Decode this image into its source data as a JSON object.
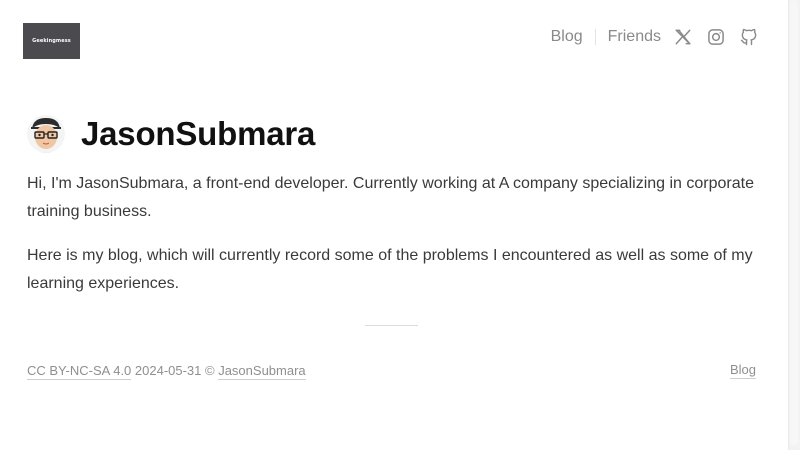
{
  "header": {
    "logo_text": "Geekingmess",
    "nav": {
      "blog_label": "Blog",
      "friends_label": "Friends",
      "icons": [
        "x-twitter-icon",
        "instagram-icon",
        "github-icon"
      ]
    }
  },
  "main": {
    "title": "JasonSubmara",
    "paragraphs": [
      "Hi, I'm JasonSubmara, a front-end developer. Currently working at A company specializing in corporate training business.",
      "Here is my blog, which will currently record some of the problems I encountered as well as some of my learning experiences."
    ]
  },
  "footer": {
    "license_label": "CC BY-NC-SA 4.0",
    "date_text": " 2024-05-31 © ",
    "author_label": "JasonSubmara",
    "blog_label": "Blog"
  },
  "colors": {
    "logo_bg": "#4a4a4f",
    "nav_text": "#8a8a8a",
    "title_text": "#111111",
    "body_text": "#3a3a3a",
    "footer_text": "#8f8f8f"
  }
}
